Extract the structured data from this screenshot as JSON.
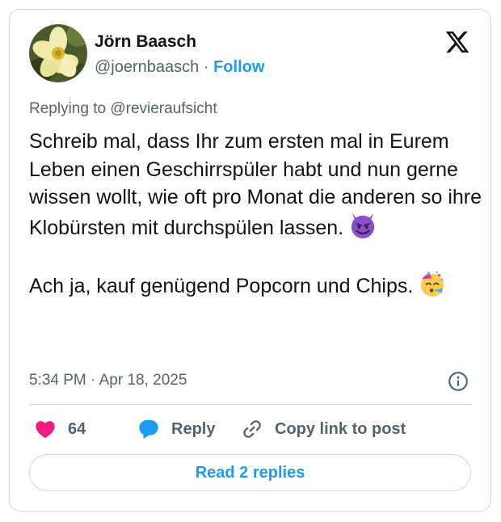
{
  "author": {
    "name": "Jörn Baasch",
    "handle": "@joernbaasch",
    "separator": "·",
    "follow_label": "Follow",
    "avatar_icon": "yellow-flower-avatar"
  },
  "platform_icon": "x-logo-icon",
  "replying_to": "Replying to @revieraufsicht",
  "tweet": {
    "paragraph_1": "Schreib mal, dass Ihr zum ersten mal in Eurem Leben einen Geschirrspüler habt und nun gerne wissen wollt, wie oft pro Monat die anderen so ihre Klobürsten mit durchspülen lassen.",
    "emoji_1": "smiling-face-with-horns",
    "paragraph_2": "Ach ja, kauf genügend Popcorn und Chips.",
    "emoji_2": "partying-face"
  },
  "timestamp": "5:34 PM · Apr 18, 2025",
  "actions": {
    "like_count": "64",
    "reply_label": "Reply",
    "copy_label": "Copy link to post"
  },
  "read_replies_label": "Read 2 replies",
  "colors": {
    "accent": "#1d9bf0",
    "like": "#f91880",
    "text": "#0f1419",
    "muted": "#536471",
    "border": "#cfd9de",
    "emoji_horns": "#8b4fc9",
    "emoji_party": "#ffcc4d"
  }
}
